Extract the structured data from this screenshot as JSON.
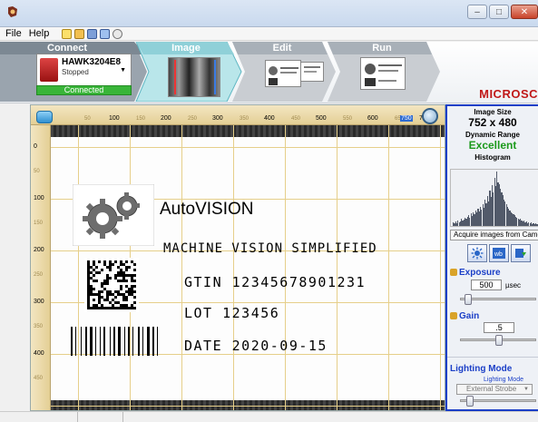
{
  "menu": {
    "file": "File",
    "help": "Help"
  },
  "workflow": {
    "steps": [
      {
        "title": "Connect"
      },
      {
        "title": "Image"
      },
      {
        "title": "Edit"
      },
      {
        "title": "Run"
      }
    ],
    "camera": {
      "name": "HAWK3204E8",
      "status": "Stopped",
      "connection": "Connected"
    },
    "brand": "MICROSC"
  },
  "ruler": {
    "top_major": [
      "100",
      "200",
      "300",
      "400",
      "500",
      "600",
      "700"
    ],
    "top_minor": [
      "50",
      "150",
      "250",
      "350",
      "450",
      "550",
      "650"
    ],
    "top_current": "750",
    "left_major": [
      "0",
      "100",
      "200",
      "300",
      "400"
    ],
    "left_minor": [
      "50",
      "150",
      "250",
      "350",
      "450"
    ]
  },
  "label": {
    "brand": "AutoVISION",
    "tagline": "MACHINE VISION SIMPLIFIED",
    "gtin": "GTIN 12345678901231",
    "lot": "LOT 123456",
    "date": "DATE 2020-09-15"
  },
  "panel": {
    "image_size_label": "Image Size",
    "image_size_value": "752 x 480",
    "dynamic_range_label": "Dynamic Range",
    "dynamic_range_value": "Excellent",
    "histogram_label": "Histogram",
    "acquire_label": "Acquire images from Came",
    "exposure_label": "Exposure",
    "exposure_value": "500",
    "exposure_unit": "µsec",
    "gain_label": "Gain",
    "gain_value": ".5",
    "lighting_label": "Lighting Mode",
    "lighting_sub": "Lighting Mode",
    "lighting_value": "External Strobe",
    "gain_level": 0.5,
    "exposure_level": 0.05
  },
  "histogram": [
    4,
    3,
    5,
    3,
    6,
    4,
    5,
    8,
    6,
    7,
    9,
    8,
    10,
    12,
    9,
    14,
    11,
    16,
    13,
    18,
    15,
    20,
    17,
    22,
    19,
    25,
    21,
    30,
    26,
    34,
    28,
    40,
    33,
    47,
    38,
    55,
    45,
    62,
    50,
    48,
    42,
    38,
    35,
    30,
    28,
    25,
    22,
    20,
    18,
    16,
    14,
    13,
    12,
    10,
    9,
    8,
    7,
    8,
    6,
    5,
    6,
    4,
    5,
    3,
    4,
    3,
    4,
    2,
    3,
    2,
    3,
    2,
    2,
    1,
    2
  ]
}
